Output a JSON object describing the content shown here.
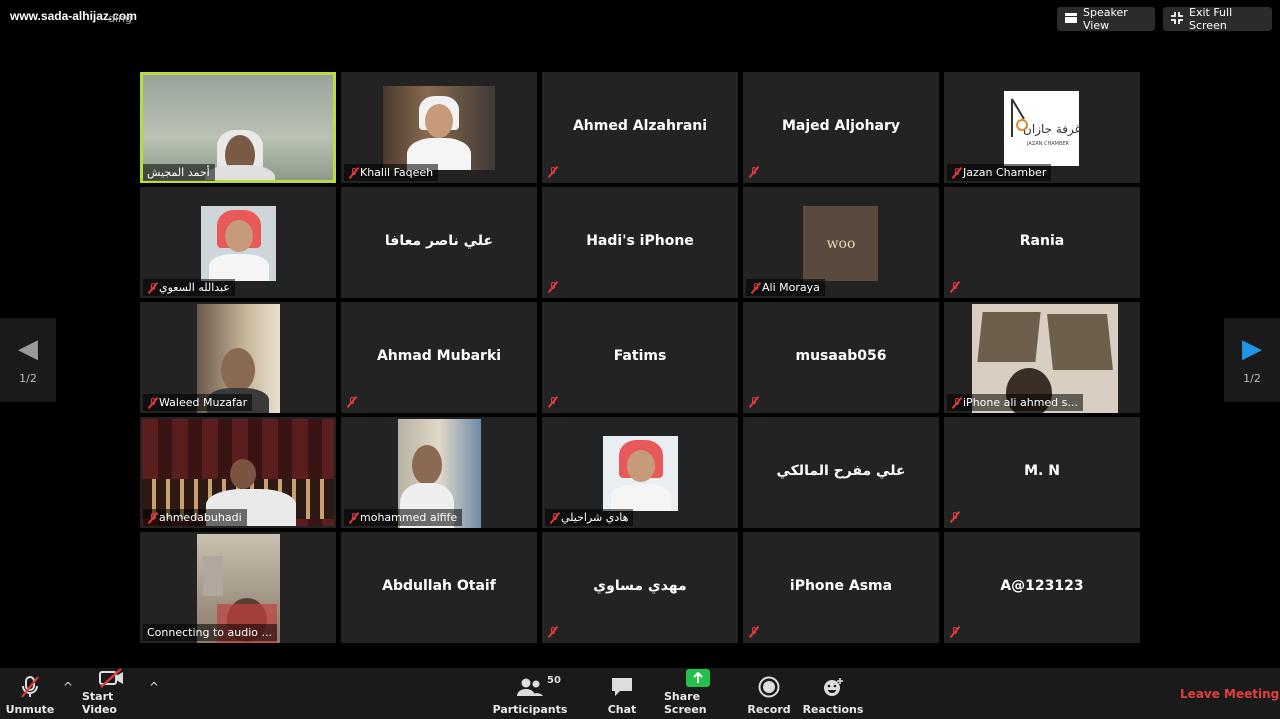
{
  "watermark": "www.sada-alhijaz.com",
  "recording_status": "ding",
  "top_buttons": {
    "speaker_view": "Speaker View",
    "exit_full_screen": "Exit Full Screen"
  },
  "pagination": {
    "left": "1/2",
    "right": "1/2"
  },
  "tiles": [
    {
      "name": "أحمد المجيش",
      "display": "video",
      "muted": false
    },
    {
      "name": "Khalil Faqeeh",
      "display": "video",
      "muted": true
    },
    {
      "name": "Ahmed Alzahrani",
      "display": "name",
      "muted": true
    },
    {
      "name": "Majed Aljohary",
      "display": "name",
      "muted": true
    },
    {
      "name": "Jazan Chamber",
      "display": "logo",
      "muted": true,
      "logo_text": "غرفة جازان",
      "logo_sub": "JAZAN CHAMBER"
    },
    {
      "name": "عبدالله السعوي",
      "display": "video",
      "muted": true
    },
    {
      "name": "علي ناصر معافا",
      "display": "name",
      "muted": false
    },
    {
      "name": "Hadi's iPhone",
      "display": "name",
      "muted": true
    },
    {
      "name": "Ali Moraya",
      "display": "logo",
      "muted": true,
      "logo_text": "woo"
    },
    {
      "name": "Rania",
      "display": "name",
      "muted": true
    },
    {
      "name": "Waleed Muzafar",
      "display": "video",
      "muted": true
    },
    {
      "name": "Ahmad Mubarki",
      "display": "name",
      "muted": true
    },
    {
      "name": "Fatims",
      "display": "name",
      "muted": true
    },
    {
      "name": "musaab056",
      "display": "name",
      "muted": true
    },
    {
      "name": "iPhone ali ahmed s...",
      "display": "video",
      "muted": true
    },
    {
      "name": "ahmedabuhadi",
      "display": "video",
      "muted": true
    },
    {
      "name": "mohammed alfife",
      "display": "video",
      "muted": true
    },
    {
      "name": "هادي شراحيلي",
      "display": "video",
      "muted": true
    },
    {
      "name": "علي مفرح المالكي",
      "display": "name",
      "muted": false
    },
    {
      "name": "M. N",
      "display": "name",
      "muted": true
    },
    {
      "name": "Connecting to audio ...",
      "display": "video",
      "muted": false
    },
    {
      "name": "Abdullah Otaif",
      "display": "name",
      "muted": false
    },
    {
      "name": "مهدي مساوي",
      "display": "name",
      "muted": true
    },
    {
      "name": "iPhone Asma",
      "display": "name",
      "muted": true
    },
    {
      "name": "A@123123",
      "display": "name",
      "muted": true
    }
  ],
  "toolbar": {
    "unmute": "Unmute",
    "start_video": "Start Video",
    "participants": "Participants",
    "participants_count": "50",
    "chat": "Chat",
    "share_screen": "Share Screen",
    "record": "Record",
    "reactions": "Reactions",
    "leave": "Leave Meeting"
  },
  "colors": {
    "active_speaker": "#b7dd45",
    "muted_icon": "#e03a3a",
    "leave": "#e0403c",
    "share": "#23c04a",
    "nav_active": "#1f95e6"
  }
}
